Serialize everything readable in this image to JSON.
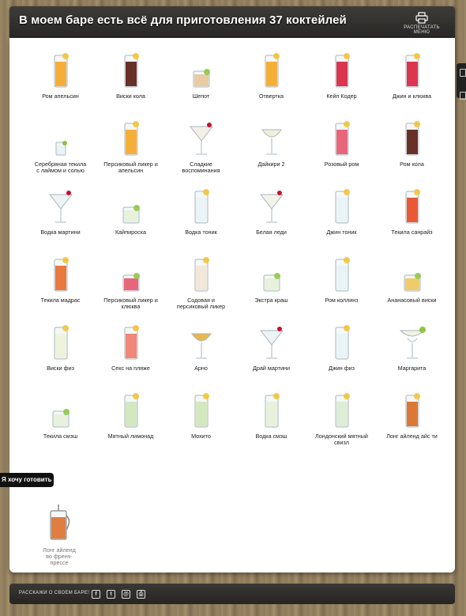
{
  "header": {
    "title": "В моем баре есть всё для приготовления 37 коктейлей",
    "print_label": "РАСПЕЧАТАТЬ МЕНЮ"
  },
  "cocktails": [
    {
      "name": "Ром апельсин",
      "glass": "tall",
      "color": "#f5a623"
    },
    {
      "name": "Виски кола",
      "glass": "tall",
      "color": "#5a1a10"
    },
    {
      "name": "Шепот",
      "glass": "rocks",
      "color": "#e8c79a"
    },
    {
      "name": "Отвертка",
      "glass": "tall",
      "color": "#f5a623"
    },
    {
      "name": "Кейп Кодер",
      "glass": "tall",
      "color": "#d81f3c"
    },
    {
      "name": "Джин и клюква",
      "glass": "tall",
      "color": "#d81f3c"
    },
    {
      "name": "Серебряная текила с лаймом и солью",
      "glass": "shot",
      "color": "#e9f2f5"
    },
    {
      "name": "Персиковый ликер и апельсин",
      "glass": "tall",
      "color": "#f5a623"
    },
    {
      "name": "Сладкие воспоминания",
      "glass": "martini",
      "color": "#f3f0e8"
    },
    {
      "name": "Дайкири 2",
      "glass": "coupe",
      "color": "#f1eedc"
    },
    {
      "name": "Розовый ром",
      "glass": "tall",
      "color": "#e8556b"
    },
    {
      "name": "Ром кола",
      "glass": "tall",
      "color": "#5a1a10"
    },
    {
      "name": "Водка мартини",
      "glass": "martini",
      "color": "#eef3f5"
    },
    {
      "name": "Кайпироска",
      "glass": "rocks",
      "color": "#e6f0d8"
    },
    {
      "name": "Водка тоник",
      "glass": "tall",
      "color": "#e9f2f5"
    },
    {
      "name": "Белая леди",
      "glass": "martini",
      "color": "#f4f3ea"
    },
    {
      "name": "Джин тоник",
      "glass": "tall",
      "color": "#e9f2f5"
    },
    {
      "name": "Текила санрайз",
      "glass": "tall",
      "color": "#e8471f"
    },
    {
      "name": "Текила мадрас",
      "glass": "tall",
      "color": "#e86a2a"
    },
    {
      "name": "Персиковый ликер и клюква",
      "glass": "rocks",
      "color": "#e8556b"
    },
    {
      "name": "Содовая и персиковый ликер",
      "glass": "tall",
      "color": "#f2e6d6"
    },
    {
      "name": "Экстра краш",
      "glass": "rocks",
      "color": "#e6f0d8"
    },
    {
      "name": "Ром коллинз",
      "glass": "tall",
      "color": "#e9f2f5"
    },
    {
      "name": "Ананасовый виски",
      "glass": "rocks",
      "color": "#f0c55a"
    },
    {
      "name": "Виски физ",
      "glass": "tall",
      "color": "#eef2d8"
    },
    {
      "name": "Секс на пляже",
      "glass": "tall",
      "color": "#f07a6a"
    },
    {
      "name": "Арно",
      "glass": "coupe",
      "color": "#e8b84a"
    },
    {
      "name": "Драй мартини",
      "glass": "martini",
      "color": "#eef3f5"
    },
    {
      "name": "Джин физ",
      "glass": "tall",
      "color": "#e9f2f5"
    },
    {
      "name": "Маргарита",
      "glass": "margarita",
      "color": "#eef4e0"
    },
    {
      "name": "Текила смэш",
      "glass": "rocks",
      "color": "#e6f0d8"
    },
    {
      "name": "Мятный лимонад",
      "glass": "tall",
      "color": "#cfe6b8"
    },
    {
      "name": "Мохито",
      "glass": "tall",
      "color": "#cfe6b8"
    },
    {
      "name": "Водка смэш",
      "glass": "tall",
      "color": "#e6f0d8"
    },
    {
      "name": "Лондонский мятный свизл",
      "glass": "tall",
      "color": "#dcebd0"
    },
    {
      "name": "Лонг айленд айс ти",
      "glass": "tall",
      "color": "#d9691f"
    }
  ],
  "want_section": {
    "tab_label": "Я хочу готовить",
    "items": [
      {
        "name": "Лонг айленд во френч-прессе",
        "glass": "frenchpress",
        "color": "#d9691f"
      }
    ]
  },
  "side_tabs": [
    {
      "icon": "notepad-icon"
    },
    {
      "icon": "list-icon"
    }
  ],
  "footer": {
    "tell_label": "РАССКАЖИ О СВОЕМ БАРЕ!",
    "share_icons": [
      {
        "icon": "facebook-icon",
        "glyph": "f"
      },
      {
        "icon": "twitter-icon",
        "glyph": "t"
      },
      {
        "icon": "vk-icon",
        "glyph": "@"
      },
      {
        "icon": "print-icon",
        "glyph": "⎙"
      }
    ]
  }
}
